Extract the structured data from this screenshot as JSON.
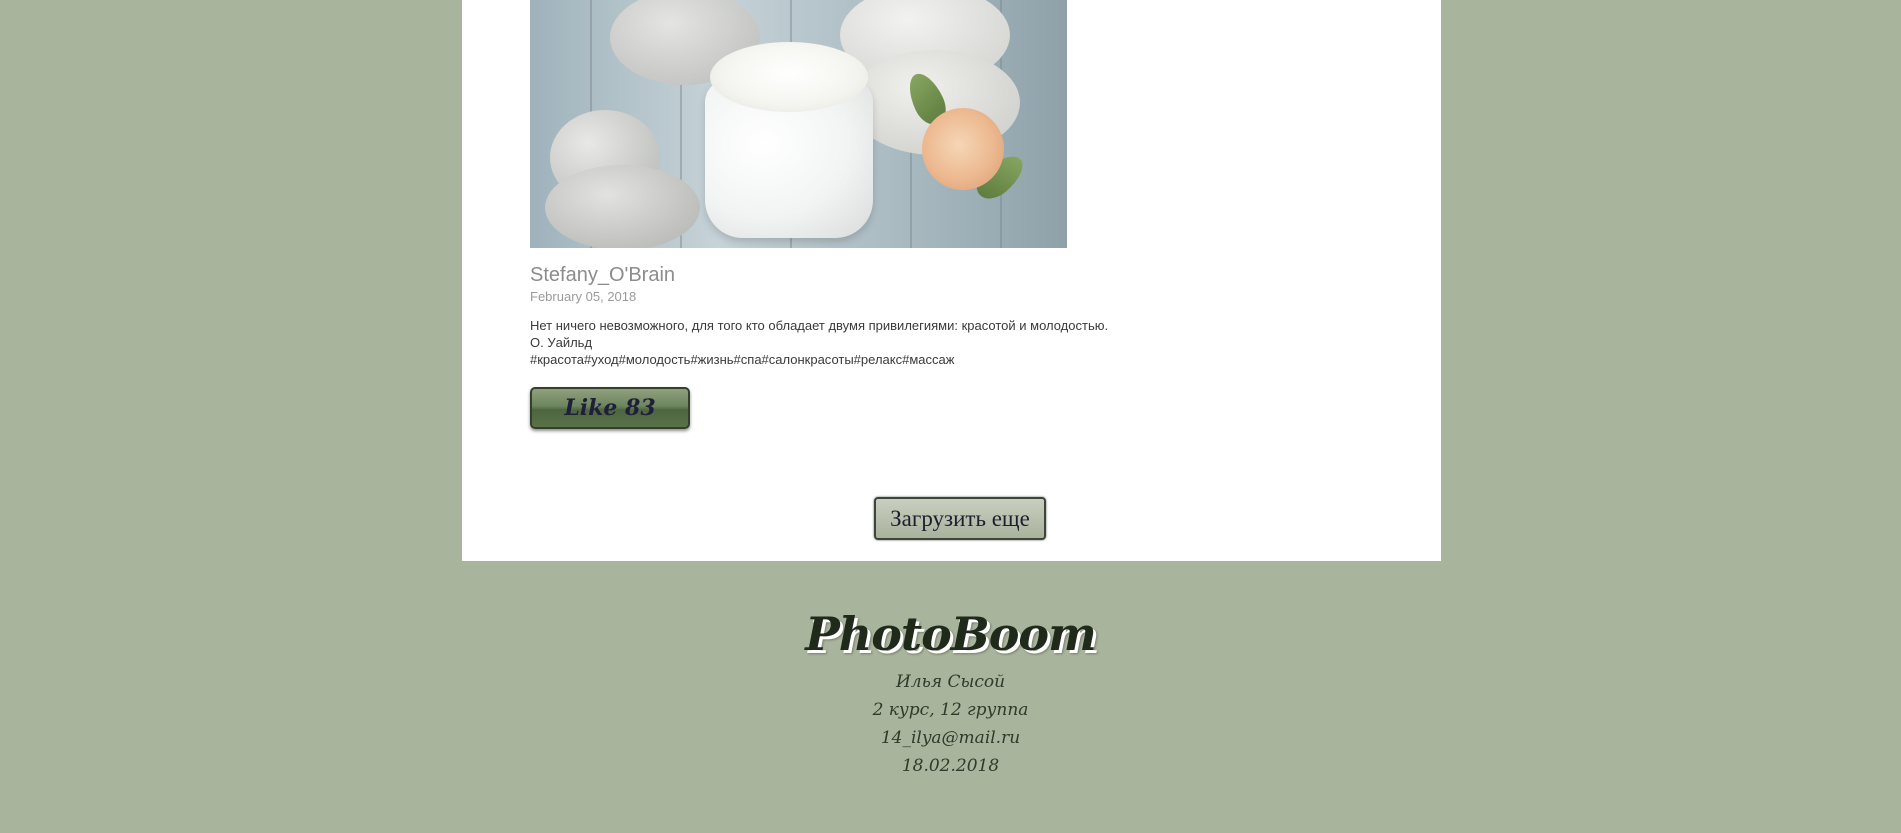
{
  "post": {
    "author": "Stefany_O'Brain",
    "date": "February 05, 2018",
    "text_lines": [
      "Нет ничего невозможного, для того кто обладает двумя привилегиями: красотой и молодостью.",
      "О. Уайльд",
      "#красота#уход#молодость#жизнь#спа#салонкрасоты#релакс#массаж"
    ],
    "like_label": "Like 83"
  },
  "load_more_label": "Загрузить еще",
  "footer": {
    "brand": "PhotoBoom",
    "lines": [
      "Илья Сысой",
      "2 курс, 12 группа",
      "14_ilya@mail.ru",
      "18.02.2018"
    ]
  }
}
